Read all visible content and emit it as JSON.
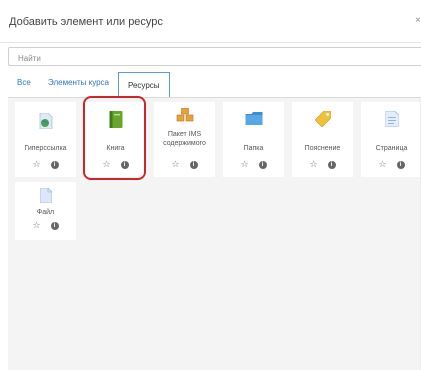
{
  "dialog": {
    "title": "Добавить элемент или ресурс",
    "close_label": "×"
  },
  "search": {
    "placeholder": "Найти"
  },
  "tabs": [
    {
      "label": "Все",
      "active": false
    },
    {
      "label": "Элементы курса",
      "active": false
    },
    {
      "label": "Ресурсы",
      "active": true
    }
  ],
  "resources": [
    {
      "name": "Гиперссылка",
      "icon": "globe-link-icon"
    },
    {
      "name": "Книга",
      "icon": "book-icon",
      "highlighted": true
    },
    {
      "name": "Пакет IMS содержимого",
      "icon": "ims-package-icon"
    },
    {
      "name": "Папка",
      "icon": "folder-icon"
    },
    {
      "name": "Пояснение",
      "icon": "tag-icon"
    },
    {
      "name": "Страница",
      "icon": "page-icon"
    },
    {
      "name": "Файл",
      "icon": "file-icon"
    }
  ],
  "actions": {
    "star_glyph": "☆",
    "info_glyph": "i"
  },
  "colors": {
    "highlight": "#d0242b",
    "active_tab_border": "#5b9ad8",
    "link": "#2b78c2"
  }
}
